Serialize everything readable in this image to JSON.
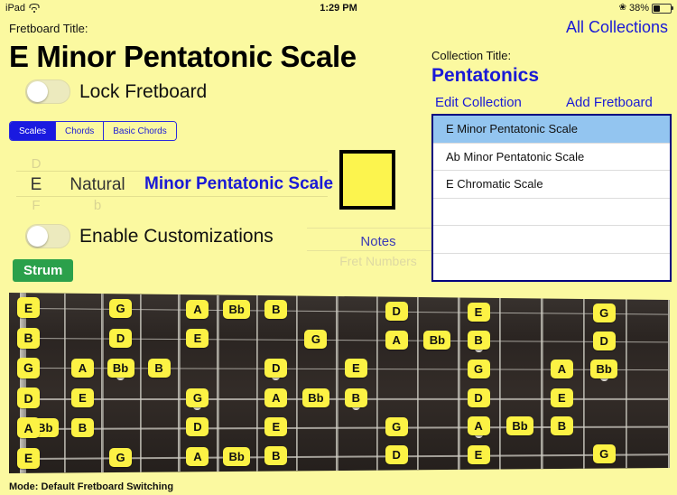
{
  "status_bar": {
    "device": "iPad",
    "wifi_icon": "wifi-icon",
    "time": "1:29 PM",
    "bluetooth_icon": "bluetooth-icon",
    "battery_percent": "38%"
  },
  "left_panel": {
    "fretboard_title_label": "Fretboard Title:",
    "fretboard_title": "E  Minor Pentatonic Scale",
    "lock_fretboard_label": "Lock Fretboard",
    "lock_fretboard_on": false,
    "segmented": {
      "items": [
        "Scales",
        "Chords",
        "Basic Chords"
      ],
      "selected": "Scales"
    },
    "picker": {
      "root_above": "D",
      "root_selected": "E",
      "root_below": "F",
      "accidental_selected": "Natural",
      "accidental_below": "b",
      "scale_selected": "Minor Pentatonic Scale"
    },
    "color_swatch": "#fcf44e",
    "enable_customizations_label": "Enable Customizations",
    "enable_customizations_on": false,
    "strum_label": "Strum",
    "display_picker": {
      "selected": "Notes",
      "next": "Fret Numbers"
    }
  },
  "right_panel": {
    "all_collections": "All Collections",
    "collection_title_label": "Collection Title:",
    "collection_title": "Pentatonics",
    "edit_collection": "Edit Collection",
    "add_fretboard": "Add Fretboard",
    "list": [
      {
        "label": "E  Minor Pentatonic Scale",
        "selected": true
      },
      {
        "label": "Ab  Minor Pentatonic Scale",
        "selected": false
      },
      {
        "label": "E  Chromatic Scale",
        "selected": false
      },
      {
        "label": "",
        "selected": false
      },
      {
        "label": "",
        "selected": false
      },
      {
        "label": "",
        "selected": false
      }
    ]
  },
  "fretboard": {
    "open_strings": [
      "E",
      "B",
      "G",
      "D",
      "A",
      "E"
    ],
    "notes": [
      {
        "string": 0,
        "fret": 3,
        "label": "G"
      },
      {
        "string": 0,
        "fret": 5,
        "label": "A"
      },
      {
        "string": 0,
        "fret": 6,
        "label": "Bb"
      },
      {
        "string": 0,
        "fret": 7,
        "label": "B"
      },
      {
        "string": 0,
        "fret": 10,
        "label": "D"
      },
      {
        "string": 0,
        "fret": 12,
        "label": "E"
      },
      {
        "string": 0,
        "fret": 15,
        "label": "G"
      },
      {
        "string": 1,
        "fret": 3,
        "label": "D"
      },
      {
        "string": 1,
        "fret": 5,
        "label": "E"
      },
      {
        "string": 1,
        "fret": 8,
        "label": "G"
      },
      {
        "string": 1,
        "fret": 10,
        "label": "A"
      },
      {
        "string": 1,
        "fret": 11,
        "label": "Bb"
      },
      {
        "string": 1,
        "fret": 12,
        "label": "B"
      },
      {
        "string": 1,
        "fret": 15,
        "label": "D"
      },
      {
        "string": 2,
        "fret": 2,
        "label": "A"
      },
      {
        "string": 2,
        "fret": 3,
        "label": "Bb"
      },
      {
        "string": 2,
        "fret": 4,
        "label": "B"
      },
      {
        "string": 2,
        "fret": 7,
        "label": "D"
      },
      {
        "string": 2,
        "fret": 9,
        "label": "E"
      },
      {
        "string": 2,
        "fret": 12,
        "label": "G"
      },
      {
        "string": 2,
        "fret": 14,
        "label": "A"
      },
      {
        "string": 2,
        "fret": 15,
        "label": "Bb"
      },
      {
        "string": 3,
        "fret": 2,
        "label": "E"
      },
      {
        "string": 3,
        "fret": 5,
        "label": "G"
      },
      {
        "string": 3,
        "fret": 7,
        "label": "A"
      },
      {
        "string": 3,
        "fret": 8,
        "label": "Bb"
      },
      {
        "string": 3,
        "fret": 9,
        "label": "B"
      },
      {
        "string": 3,
        "fret": 12,
        "label": "D"
      },
      {
        "string": 3,
        "fret": 14,
        "label": "E"
      },
      {
        "string": 4,
        "fret": 1,
        "label": "Bb"
      },
      {
        "string": 4,
        "fret": 2,
        "label": "B"
      },
      {
        "string": 4,
        "fret": 5,
        "label": "D"
      },
      {
        "string": 4,
        "fret": 7,
        "label": "E"
      },
      {
        "string": 4,
        "fret": 10,
        "label": "G"
      },
      {
        "string": 4,
        "fret": 12,
        "label": "A"
      },
      {
        "string": 4,
        "fret": 13,
        "label": "Bb"
      },
      {
        "string": 4,
        "fret": 14,
        "label": "B"
      },
      {
        "string": 5,
        "fret": 3,
        "label": "G"
      },
      {
        "string": 5,
        "fret": 5,
        "label": "A"
      },
      {
        "string": 5,
        "fret": 6,
        "label": "Bb"
      },
      {
        "string": 5,
        "fret": 7,
        "label": "B"
      },
      {
        "string": 5,
        "fret": 10,
        "label": "D"
      },
      {
        "string": 5,
        "fret": 12,
        "label": "E"
      },
      {
        "string": 5,
        "fret": 15,
        "label": "G"
      }
    ],
    "inlay_dots": [
      {
        "fret": 3,
        "string_gap": 2
      },
      {
        "fret": 5,
        "string_gap": 3
      },
      {
        "fret": 7,
        "string_gap": 2
      },
      {
        "fret": 9,
        "string_gap": 3
      },
      {
        "fret": 12,
        "string_gap": 1
      },
      {
        "fret": 12,
        "string_gap": 4
      },
      {
        "fret": 15,
        "string_gap": 2
      }
    ]
  },
  "footer": {
    "mode_text": "Mode: Default Fretboard Switching"
  }
}
